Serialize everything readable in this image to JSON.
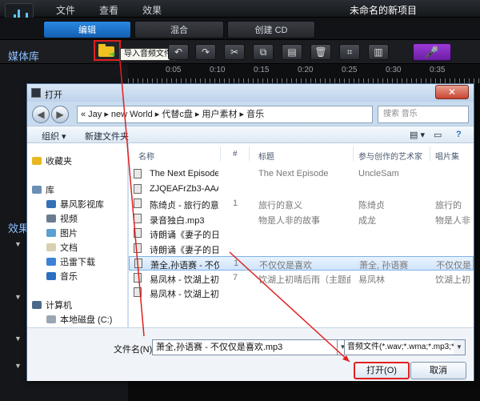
{
  "app": {
    "menu": [
      "文件",
      "查看",
      "效果"
    ],
    "project_title": "未命名的新项目"
  },
  "modes": {
    "edit": "编辑",
    "mix": "混合",
    "burn_cd": "创建 CD"
  },
  "toolbar": {
    "media_library": "媒体库",
    "import_tooltip": "导入音频文件",
    "effects_label": "效果"
  },
  "timeline": {
    "ticks": [
      "0:05",
      "0:10",
      "0:15",
      "0:20",
      "0:25",
      "0:30",
      "0:35"
    ]
  },
  "dialog": {
    "title": "打开",
    "close": "✕",
    "address": "«  Jay  ▸  new World  ▸  代替c盘  ▸  用户素材  ▸  音乐",
    "search_placeholder": "搜索 音乐",
    "organize": "组织 ▾",
    "new_folder": "新建文件夹",
    "nav": {
      "favorites": "收藏夹",
      "library": "库",
      "lib_items": [
        "暴风影视库",
        "视频",
        "图片",
        "文档",
        "迅雷下载",
        "音乐"
      ],
      "computer": "计算机",
      "disk": "本地磁盘 (C:)"
    },
    "columns": {
      "name": "名称",
      "num": "#",
      "title": "标题",
      "artist": "参与创作的艺术家",
      "album": "唱片集"
    },
    "files": [
      {
        "name": "The Next Episode...",
        "num": "",
        "title": "The Next Episode",
        "artist": "UncleSam",
        "album": ""
      },
      {
        "name": "ZJQEAFrZb3-AAAz...",
        "num": "",
        "title": "",
        "artist": "",
        "album": ""
      },
      {
        "name": "陈绮贞 - 旅行的意...",
        "num": "1",
        "title": "旅行的意义",
        "artist": "陈绮贞",
        "album": "旅行的"
      },
      {
        "name": "录音独白.mp3",
        "num": "",
        "title": "物是人非的故事",
        "artist": "成龙",
        "album": "物是人非"
      },
      {
        "name": "诗朗诵《妻子的日...",
        "num": "",
        "title": "",
        "artist": "",
        "album": ""
      },
      {
        "name": "诗朗诵《妻子的日...",
        "num": "",
        "title": "",
        "artist": "",
        "album": ""
      },
      {
        "name": "萧全,孙语赛 - 不仅...",
        "num": "1",
        "title": "不仅仅是喜欢",
        "artist": "萧全, 孙语赛",
        "album": "不仅仅是"
      },
      {
        "name": "易凤林 - 饮湖上初...",
        "num": "7",
        "title": "饮湖上初晴后雨（主题曲）",
        "artist": "易凤林",
        "album": "饮湖上初"
      },
      {
        "name": "易凤林 - 饮湖上初...",
        "num": "",
        "title": "",
        "artist": "",
        "album": ""
      }
    ],
    "selected_index": 6,
    "filename_label": "文件名(N):",
    "filename_value": "萧全,孙语赛 - 不仅仅是喜欢.mp3",
    "filetype": "音频文件(*.wav;*.wma;*.mp3;*",
    "open_button": "打开(O)",
    "cancel_button": "取消"
  },
  "colors": {
    "accent": "#1f7ad8",
    "highlight": "#e02020",
    "mic": "#8a2bc6"
  }
}
